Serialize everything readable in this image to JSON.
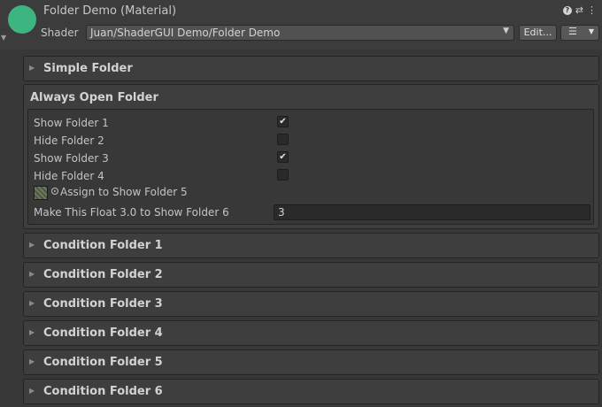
{
  "header": {
    "title": "Folder Demo (Material)",
    "shader_label": "Shader",
    "shader_value": "Juan/ShaderGUI Demo/Folder Demo",
    "edit_label": "Edit...",
    "icons": [
      "help-icon",
      "settings-sliders-icon",
      "kebab-menu-icon"
    ],
    "thumbnail_color": "#3cb581"
  },
  "folders": {
    "simple": "Simple Folder",
    "always_open": "Always Open Folder",
    "condition": [
      "Condition Folder 1",
      "Condition Folder 2",
      "Condition Folder 3",
      "Condition Folder 4",
      "Condition Folder 5",
      "Condition Folder 6"
    ]
  },
  "properties": {
    "show1": {
      "label": "Show Folder 1",
      "checked": true
    },
    "hide2": {
      "label": "Hide Folder 2",
      "checked": false
    },
    "show3": {
      "label": "Show Folder 3",
      "checked": true
    },
    "hide4": {
      "label": "Hide Folder 4",
      "checked": false
    },
    "tex5": {
      "label": "Assign to Show Folder 5"
    },
    "float6": {
      "label": "Make This Float 3.0 to Show Folder 6",
      "value": "3"
    }
  },
  "glyphs": {
    "check": "✔",
    "collapsed": "▶",
    "dropdown": "▼"
  }
}
